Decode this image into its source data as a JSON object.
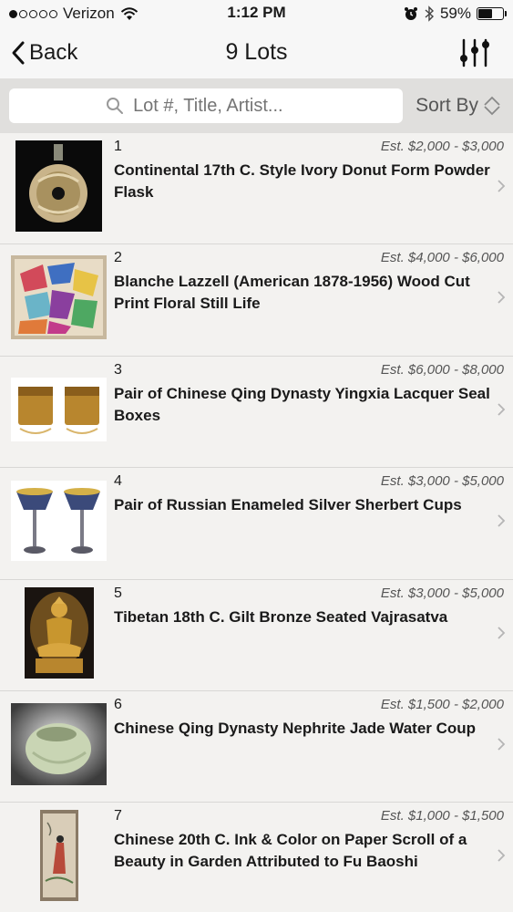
{
  "status_bar": {
    "carrier": "Verizon",
    "time": "1:12 PM",
    "battery": "59%",
    "battery_level": 0.59,
    "signal_bars_filled": 1,
    "signal_bars_total": 5
  },
  "nav": {
    "back_label": "Back",
    "title": "9 Lots"
  },
  "search": {
    "placeholder": "Lot #, Title, Artist...",
    "sort_label": "Sort By"
  },
  "lots": [
    {
      "number": "1",
      "estimate": "Est. $2,000 - $3,000",
      "title": "Continental 17th C. Style Ivory Donut Form Powder Flask",
      "image": "powder-flask"
    },
    {
      "number": "2",
      "estimate": "Est. $4,000 - $6,000",
      "title": "Blanche Lazzell (American 1878-1956) Wood Cut Print Floral Still Life",
      "image": "woodcut-print"
    },
    {
      "number": "3",
      "estimate": "Est. $6,000 - $8,000",
      "title": "Pair of Chinese Qing Dynasty Yingxia Lacquer Seal Boxes",
      "image": "lacquer-boxes"
    },
    {
      "number": "4",
      "estimate": "Est. $3,000 - $5,000",
      "title": "Pair of Russian Enameled Silver Sherbert Cups",
      "image": "sherbert-cups"
    },
    {
      "number": "5",
      "estimate": "Est. $3,000 - $5,000",
      "title": "Tibetan 18th C. Gilt Bronze Seated Vajrasatva",
      "image": "bronze-statue"
    },
    {
      "number": "6",
      "estimate": "Est. $1,500 - $2,000",
      "title": "Chinese Qing Dynasty Nephrite Jade Water Coup",
      "image": "jade-coup"
    },
    {
      "number": "7",
      "estimate": "Est. $1,000 - $1,500",
      "title": "Chinese 20th C. Ink & Color on Paper Scroll of a Beauty in Garden Attributed to Fu Baoshi",
      "image": "paper-scroll"
    }
  ]
}
